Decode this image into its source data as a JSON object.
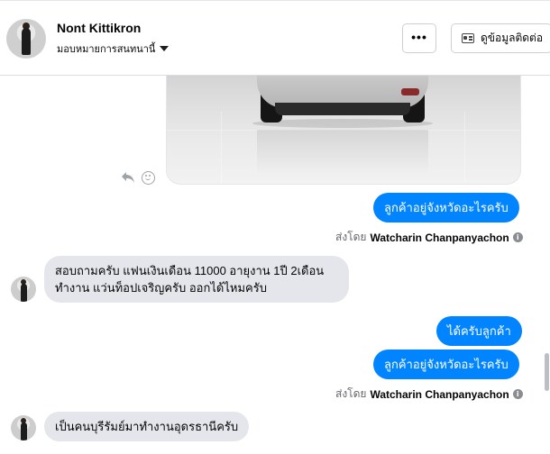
{
  "header": {
    "name": "Nont Kittikron",
    "assigned_label": "มอบหมายการสนทนานี้",
    "more_label": "•••",
    "contact_label": "ดูข้อมูลติดต่อ"
  },
  "messages": {
    "out1": "ลูกค้าอยู่จังหวัดอะไรครับ",
    "sent_by_prefix_1": "ส่งโดย",
    "sent_by_name_1": "Watcharin Chanpanyachon",
    "in1_line1": "สอบถามครับ แฟนเงินเดือน 11000  อายุงาน 1ปี 2เดือน",
    "in1_line2": "ทำงาน แว่นท็อปเจริญครับ ออกได้ไหมครับ",
    "out2": "ได้ครับลูกค้า",
    "out3": "ลูกค้าอยู่จังหวัดอะไรครับ",
    "sent_by_prefix_2": "ส่งโดย",
    "sent_by_name_2": "Watcharin Chanpanyachon",
    "in2": "เป็นคนบุรีรัมย์มาทำงานอุดรธานีครับ"
  },
  "icons": {
    "reply": "reply-icon",
    "react": "smiley-icon",
    "info": "info-icon",
    "contact": "contact-card-icon",
    "assign": "chevron-down-icon"
  },
  "colors": {
    "outgoing_bubble": "#0084ff",
    "incoming_bubble": "#e4e6eb"
  }
}
